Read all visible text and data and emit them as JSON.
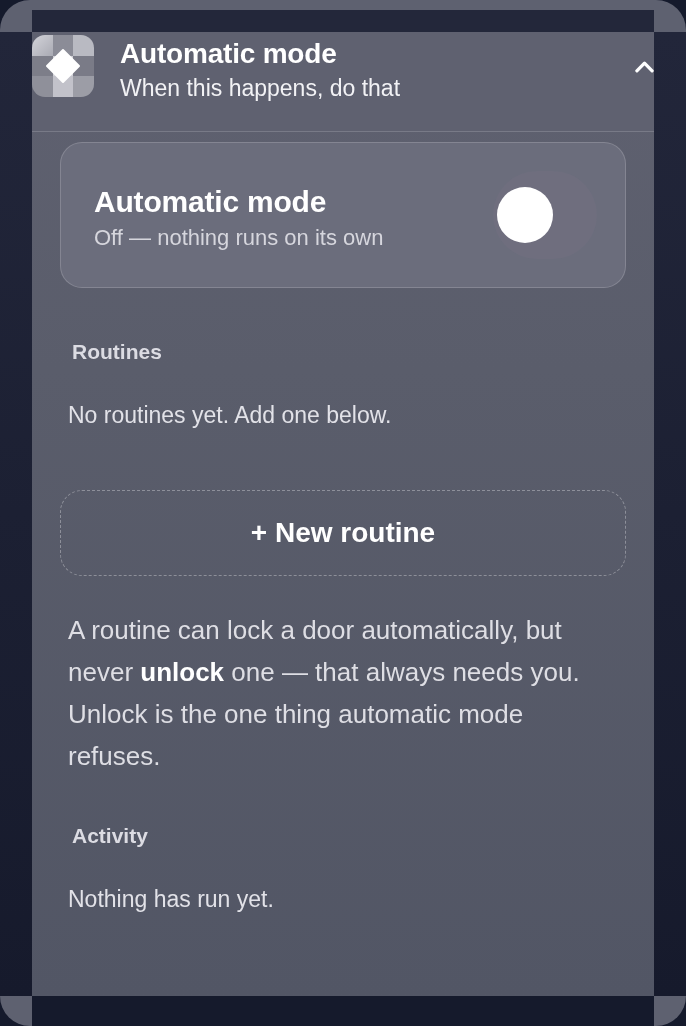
{
  "header": {
    "title": "Automatic mode",
    "subtitle": "When this happens, do that",
    "expanded": true
  },
  "mode_card": {
    "title": "Automatic mode",
    "subtitle": "Off — nothing runs on its own",
    "on": false
  },
  "routines": {
    "heading": "Routines",
    "empty_text": "No routines yet. Add one below.",
    "add_button": "+ New routine",
    "note": "A routine can lock a door automatically, but never **unlock** one — that always needs you. Unlock is the one thing automatic mode refuses."
  },
  "activity": {
    "heading": "Activity",
    "empty_text": "Nothing has run yet."
  }
}
